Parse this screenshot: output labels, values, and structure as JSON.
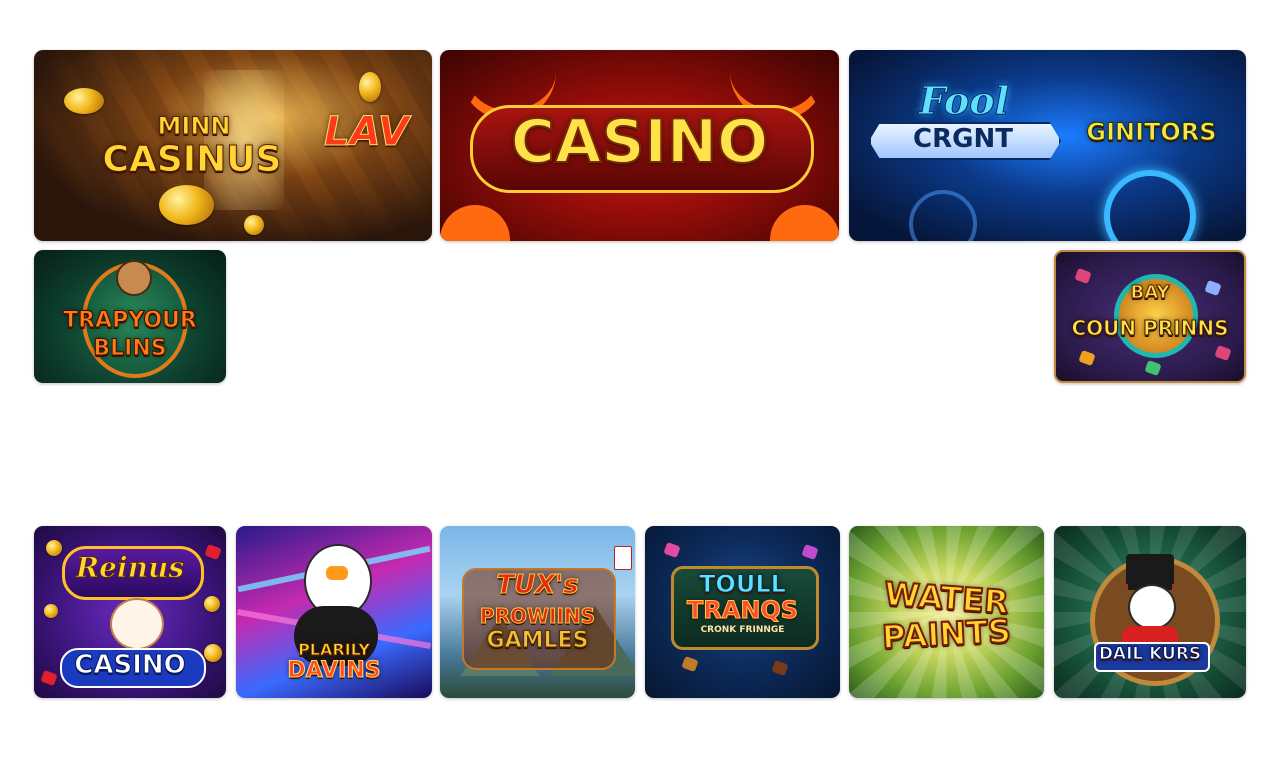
{
  "tiles": [
    {
      "id": "minn-casinus",
      "title_line1": "MINN",
      "title_line2": "CASINUS",
      "badge": "LAV"
    },
    {
      "id": "casino-red",
      "title": "CASINO"
    },
    {
      "id": "fool-crgnt",
      "script": "Fool",
      "banner": "CRGNT",
      "side": "GINITORS"
    },
    {
      "id": "trapyour-blins",
      "line1": "TRAPYOUR",
      "line2": "BLINS"
    },
    {
      "id": "coun-prinns",
      "top": "BAY",
      "title": "COUN PRINNS"
    },
    {
      "id": "reinus-casino",
      "script": "Reinus",
      "title": "CASINO"
    },
    {
      "id": "plarily-davins",
      "line1": "PLARILY",
      "line2": "DAVINS"
    },
    {
      "id": "tuxs-prowiins",
      "line1": "TUX's",
      "line2": "PROWIINS",
      "line3": "GAMLES"
    },
    {
      "id": "toull-tranqs",
      "line1": "TOULL",
      "line2": "TRANQS",
      "line3": "CRONK FRINNGE"
    },
    {
      "id": "water-paints",
      "line1": "WATER",
      "line2": "PAINTS"
    },
    {
      "id": "dail-kurs",
      "title": "DAIL KURS"
    }
  ],
  "colors": {
    "gold": "#ffd633",
    "red": "#d8101c",
    "blue": "#2a6cff",
    "purple": "#4b1e8a",
    "green": "#0f4a35"
  }
}
